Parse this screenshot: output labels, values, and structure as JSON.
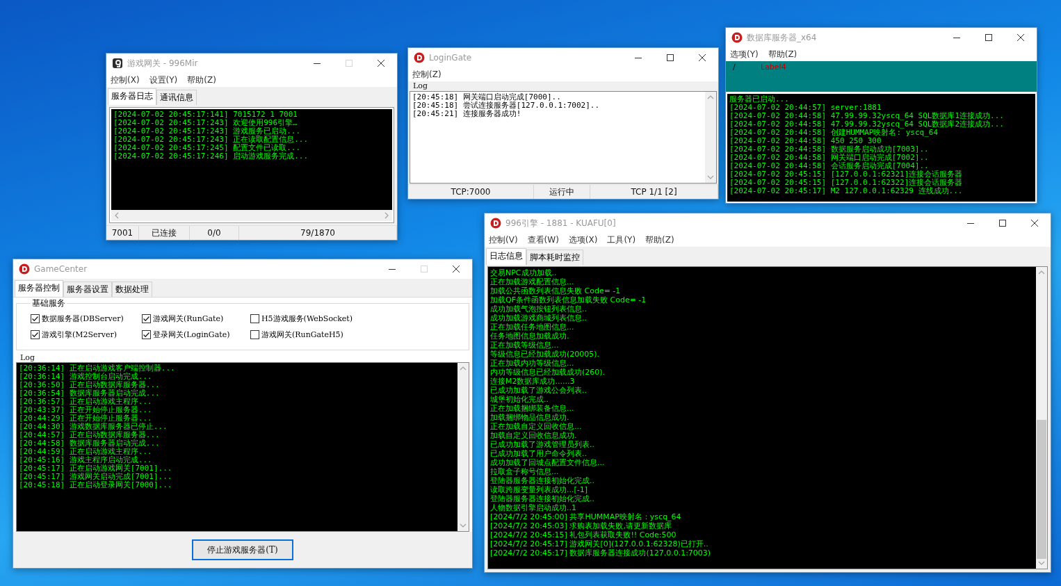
{
  "desktop": {
    "windows": [
      {
        "kind": "gate",
        "title": "游戏网关 - 996Mir",
        "maximize_disabled": true,
        "menus": [
          "控制(X)",
          "设置(Y)",
          "帮助(Z)"
        ],
        "tabs": [
          {
            "label": "服务器日志",
            "selected": true
          },
          {
            "label": "通讯信息",
            "selected": false
          }
        ],
        "log": [
          "[2024-07-02 20:45:17:141] 7015172 1 7001",
          "[2024-07-02 20:45:17:243] 欢迎使用996引擎…",
          "[2024-07-02 20:45:17:243] 游戏服务已启动...",
          "[2024-07-02 20:45:17:243] 正在读取配置信息...",
          "[2024-07-02 20:45:17:245] 配置文件已读取...",
          "[2024-07-02 20:45:17:246] 启动游戏服务完成..."
        ],
        "status_bar": [
          "7001",
          "已连接",
          "0/0",
          "79/1870"
        ]
      },
      {
        "kind": "login",
        "title": "LoginGate",
        "maximize_disabled": false,
        "menus": [
          "控制(Z)"
        ],
        "log_label": "Log",
        "log": [
          "[20:45:18] 网关端口启动完成[7000]..",
          "[20:45:18] 尝试连接服务器[127.0.0.1:7002]..",
          "[20:45:21] 连接服务器成功!"
        ],
        "status_bar": [
          "TCP:7000",
          "运行中",
          "TCP 1/1 [2]"
        ]
      },
      {
        "kind": "db",
        "title": "数据库服务器_x64",
        "maximize_disabled": false,
        "menus": [
          "选项(Y)",
          "帮助(Z)"
        ],
        "panel_labels": [
          "/",
          "Label4"
        ],
        "log": [
          "服务器已启动...",
          "[2024-07-02 20:44:57] server:1881",
          "[2024-07-02 20:44:58] 47.99.99.32yscq_64 SQL数据库1连接成功...",
          "[2024-07-02 20:44:58] 47.99.99.32yscq_64 SQL数据库2连接成功...",
          "[2024-07-02 20:44:58] 创建HUMMAP映射名: yscq_64",
          "[2024-07-02 20:44:58] 450 250 300",
          "[2024-07-02 20:44:58] 数据服务启动成功[7003]..",
          "[2024-07-02 20:44:58] 网关端口启动完成[7002]..",
          "[2024-07-02 20:44:58] 会话服务启动完成[7004]..",
          "[2024-07-02 20:45:15] [127.0.0.1:62321]连接会话服务器",
          "[2024-07-02 20:45:15] [127.0.0.1:62322]连接会话服务器",
          "[2024-07-02 20:45:17] M2 127.0.0.1:62329 连线成功..."
        ]
      },
      {
        "kind": "center",
        "title": "GameCenter",
        "maximize_disabled": true,
        "tabs": [
          {
            "label": "服务器控制",
            "selected": true
          },
          {
            "label": "服务器设置",
            "selected": false
          },
          {
            "label": "数据处理",
            "selected": false
          }
        ],
        "group_title": "基础服务",
        "services": [
          {
            "label": "数据服务器(DBServer)",
            "checked": true
          },
          {
            "label": "游戏网关(RunGate)",
            "checked": true
          },
          {
            "label": "H5游戏服务(WebSocket)",
            "checked": false
          },
          {
            "label": "游戏引擎(M2Server)",
            "checked": true
          },
          {
            "label": "登录网关(LoginGate)",
            "checked": true
          },
          {
            "label": "游戏网关(RunGateH5)",
            "checked": false
          }
        ],
        "log_label": "Log",
        "log": [
          "[20:36:14] 正在启动游戏客户端控制器...",
          "[20:36:14] 游戏控制台启动完成...",
          "[20:36:50] 正在启动数据库服务器...",
          "[20:36:54] 数据库服务器启动完成...",
          "[20:36:57] 正在启动游戏主程序...",
          "[20:43:37] 正在开始停止服务器...",
          "[20:44:29] 正在开始停止服务器...",
          "[20:44:30] 游戏数据库服务器已停止...",
          "[20:44:57] 正在启动数据库服务器...",
          "[20:44:58] 数据库服务器启动完成...",
          "[20:44:59] 正在启动游戏主程序...",
          "[20:45:16] 游戏主程序启动完成...",
          "[20:45:17] 正在启动游戏网关[7001]...",
          "[20:45:17] 游戏网关启动完成[7001]...",
          "[20:45:18] 正在启动登录网关[7000]..."
        ],
        "button": "停止游戏服务器(T)"
      },
      {
        "kind": "engine",
        "title": "996引擎 - 1881 - KUAFU[0]",
        "maximize_disabled": false,
        "menus": [
          "控制(V)",
          "查看(W)",
          "选项(X)",
          "工具(Y)",
          "帮助(Z)"
        ],
        "tabs": [
          {
            "label": "日志信息",
            "selected": true
          },
          {
            "label": "脚本耗时监控",
            "selected": false
          }
        ],
        "log": [
          "交易NPC成功加载..",
          "正在加载游戏配置信息...",
          "加载公共函数列表信息失败 Code= -1",
          "加载QF条件函数列表信息加载失败 Code= -1",
          "成功加载气泡按钮列表信息..",
          "成功加载游戏商城列表信息..",
          "正在加载任务地图信息...",
          "任务地图信息加载成功.",
          "正在加载等级信息...",
          "等级信息已经加载成功(20005).",
          "正在加载内功等级信息...",
          "内功等级信息已经加载成功(260).",
          "连接M2数据库成功......3",
          "已成功加载了游戏公会列表..",
          "城堡初始化完成..",
          "正在加载捆绑装备信息...",
          "加载捆绑物品信息成功.",
          "正在加载自定义回收信息...",
          "加载自定义回收信息成功.",
          "已成功加载了游戏管理员列表..",
          "已成功加载了用户命令列表..",
          "成功加载了回城点配置文件信息...",
          "拉取盒子称号信息...",
          "登陆器服务器连接初始化完成..",
          "读取跨服变量列表成功...[-1]",
          "登陆器服务器连接初始化完成..",
          "人物数据引擎启动成功..1",
          "[2024/7/2 20:45:00] 共享HUMMAP映射名：yscq_64",
          "[2024/7/2 20:45:03] 求购表加载失败,请更新数据库",
          "[2024/7/2 20:45:15] 礼包列表获取失败!! Code:500",
          "[2024/7/2 20:45:17] 游戏网关[0](127.0.0.1:62328)已打开..",
          "[2024/7/2 20:45:17] 数据库服务器连接成功(127.0.0.1:7003)"
        ]
      }
    ]
  }
}
